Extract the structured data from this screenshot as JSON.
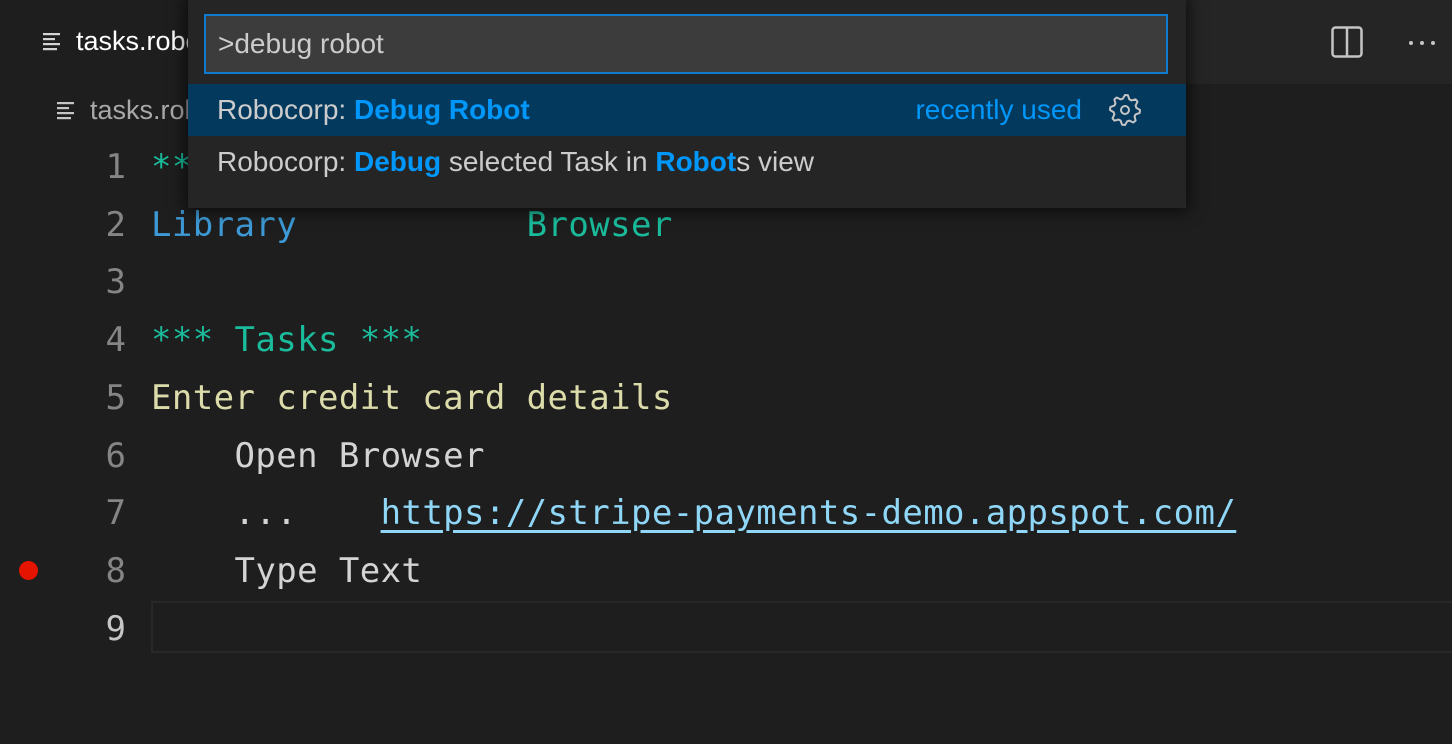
{
  "tab": {
    "label": "tasks.robot",
    "icon": "file-lines-icon"
  },
  "editor_actions": {
    "split_icon": "split-editor-icon",
    "more_icon": "more-actions-icon"
  },
  "breadcrumb": {
    "label": "tasks.robot",
    "icon": "file-lines-icon"
  },
  "command_palette": {
    "input_value": ">debug robot",
    "items": [
      {
        "prefix": "Robocorp: ",
        "segments": [
          {
            "text": "Debug Robot",
            "highlight": true
          }
        ],
        "meta": "recently used",
        "selected": true,
        "icon": "gear-icon"
      },
      {
        "prefix": "Robocorp: ",
        "segments": [
          {
            "text": "Debug",
            "highlight": true
          },
          {
            "text": " selected Task in ",
            "highlight": false
          },
          {
            "text": "Robot",
            "highlight": true
          },
          {
            "text": "s view",
            "highlight": false
          }
        ],
        "meta": "",
        "selected": false
      }
    ]
  },
  "code": {
    "lines": [
      {
        "n": "1",
        "parts": [
          {
            "t": "*** Settings ***",
            "c": "kw-section"
          }
        ]
      },
      {
        "n": "2",
        "parts": [
          {
            "t": "Library",
            "c": "kw-setting"
          },
          {
            "t": "           ",
            "c": ""
          },
          {
            "t": "Browser",
            "c": "kw-section"
          }
        ]
      },
      {
        "n": "3",
        "parts": []
      },
      {
        "n": "4",
        "parts": [
          {
            "t": "*** Tasks ***",
            "c": "kw-section"
          }
        ]
      },
      {
        "n": "5",
        "parts": [
          {
            "t": "Enter credit card details",
            "c": "kw-name"
          }
        ]
      },
      {
        "n": "6",
        "parts": [
          {
            "t": "    Open Browser",
            "c": ""
          }
        ]
      },
      {
        "n": "7",
        "parts": [
          {
            "t": "    ...    ",
            "c": ""
          },
          {
            "t": "https://stripe-payments-demo.appspot.com/",
            "c": "url"
          }
        ]
      },
      {
        "n": "8",
        "parts": [
          {
            "t": "    Type Text",
            "c": ""
          }
        ],
        "breakpoint": true
      },
      {
        "n": "9",
        "parts": [],
        "current": true
      }
    ]
  },
  "colors": {
    "accent": "#0097fb",
    "selection": "#04395e",
    "breakpoint": "#e51400",
    "focus_border": "#0e7bd1"
  }
}
